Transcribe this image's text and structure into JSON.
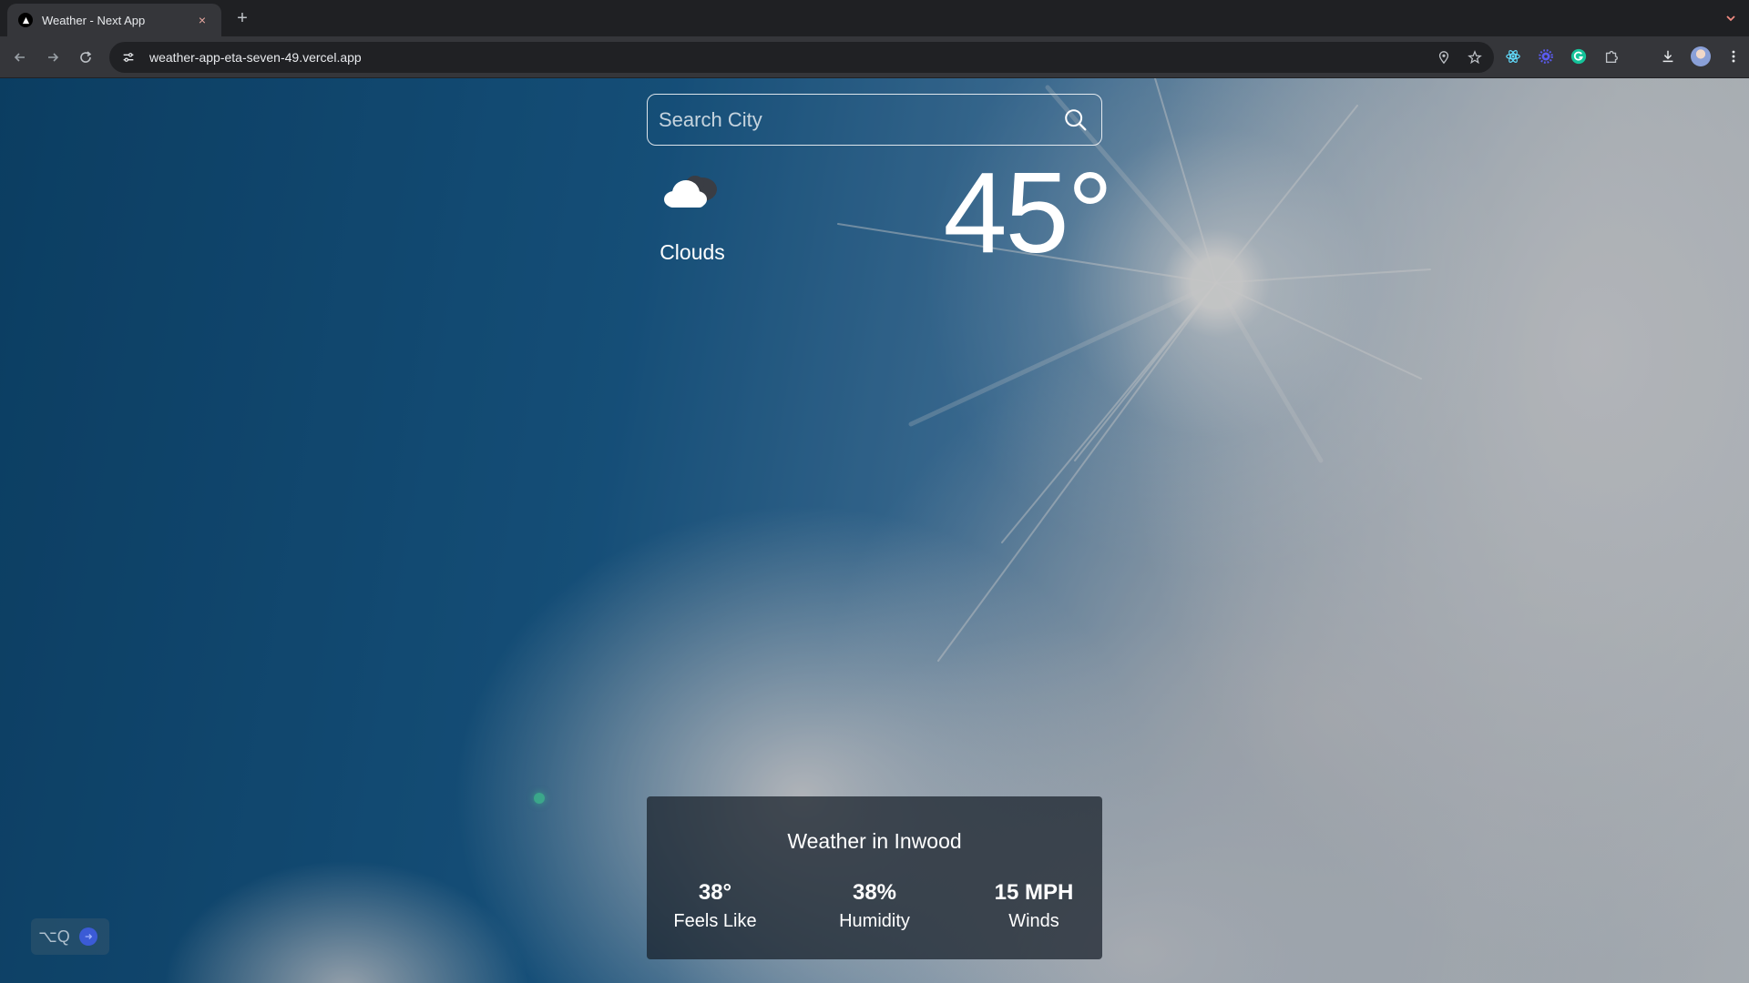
{
  "browser": {
    "tab": {
      "title": "Weather - Next App",
      "close_glyph": "×"
    },
    "new_tab_glyph": "+",
    "url": "weather-app-eta-seven-49.vercel.app"
  },
  "app": {
    "search": {
      "placeholder": "Search City",
      "value": ""
    },
    "current": {
      "icon": "cloud-icon",
      "condition": "Clouds",
      "temperature": "45°"
    },
    "card": {
      "title": "Weather in Inwood",
      "stats": [
        {
          "value": "38°",
          "label": "Feels Like"
        },
        {
          "value": "38%",
          "label": "Humidity"
        },
        {
          "value": "15 MPH",
          "label": "Winds"
        }
      ]
    },
    "widget": {
      "shortcut": "⌥Q"
    }
  },
  "colors": {
    "tab_bg": "#35363a",
    "omnibox_bg": "#202124",
    "card_bg": "#161e28",
    "sky": "#1b6499"
  }
}
